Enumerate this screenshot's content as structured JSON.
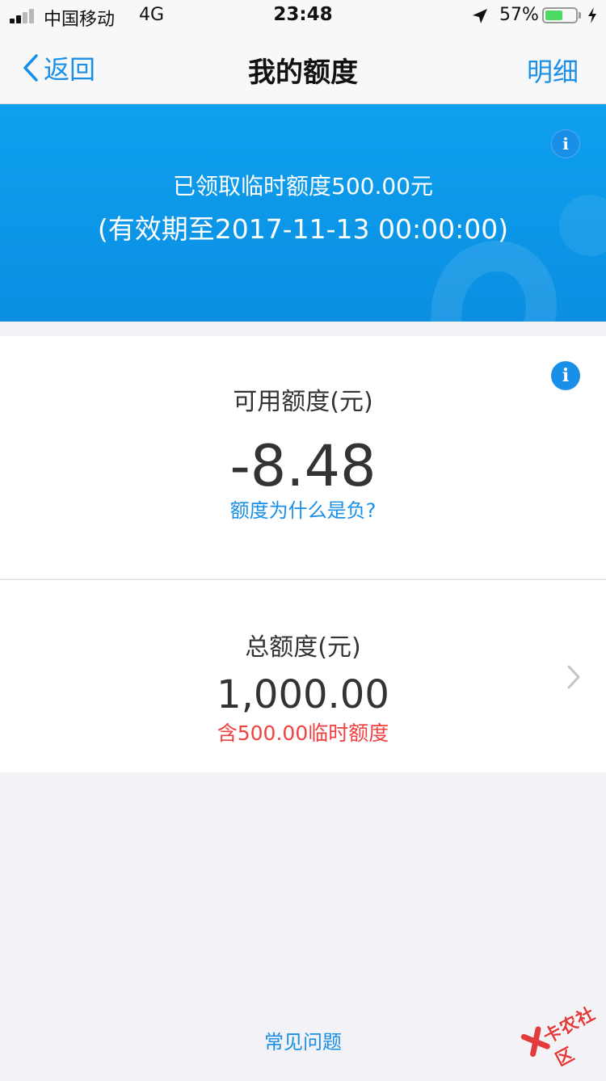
{
  "status_bar": {
    "carrier": "中国移动",
    "network": "4G",
    "time": "23:48",
    "battery_percent": "57%",
    "battery_level": 0.57
  },
  "nav": {
    "back_label": "返回",
    "title": "我的额度",
    "detail_label": "明细"
  },
  "banner": {
    "line1": "已领取临时额度500.00元",
    "line2": "(有效期至2017-11-13 00:00:00)",
    "info_icon": "info-icon"
  },
  "available": {
    "label": "可用额度(元)",
    "value": "-8.48",
    "help_link": "额度为什么是负?"
  },
  "total": {
    "label": "总额度(元)",
    "value": "1,000.00",
    "note": "含500.00临时额度"
  },
  "footer": {
    "faq_label": "常见问题"
  },
  "watermark": {
    "text": "卡农社区"
  },
  "colors": {
    "brand_blue": "#1a8fe8",
    "banner_blue": "#0ea0ee",
    "warning_red": "#f0403f",
    "background": "#f3f3f7"
  }
}
